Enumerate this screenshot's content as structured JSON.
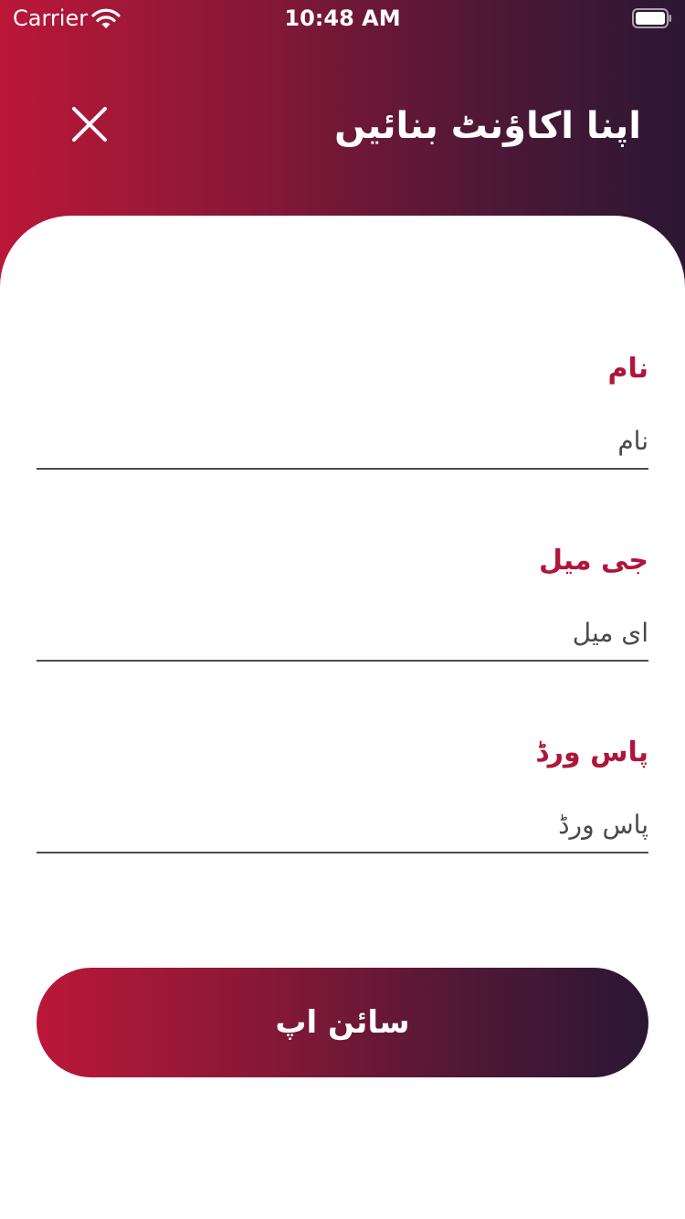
{
  "status_bar": {
    "carrier": "Carrier",
    "time": "10:48 AM",
    "wifi_icon": "wifi-icon",
    "battery_icon": "battery-icon"
  },
  "header": {
    "title": "اپنا اکاؤنٹ بنائیں",
    "close_icon": "close-icon"
  },
  "form": {
    "name": {
      "label": "نام",
      "value": "",
      "placeholder": "نام"
    },
    "email": {
      "label": "جی میل",
      "value": "",
      "placeholder": "ای میل"
    },
    "password": {
      "label": "پاس ورڈ",
      "value": "",
      "placeholder": "پاس ورڈ"
    }
  },
  "signup_button": {
    "label": "سائن اپ"
  },
  "colors": {
    "gradient_start": "#bb1739",
    "gradient_end": "#2b1733",
    "label_color": "#b0153a",
    "background": "#ffffff"
  }
}
